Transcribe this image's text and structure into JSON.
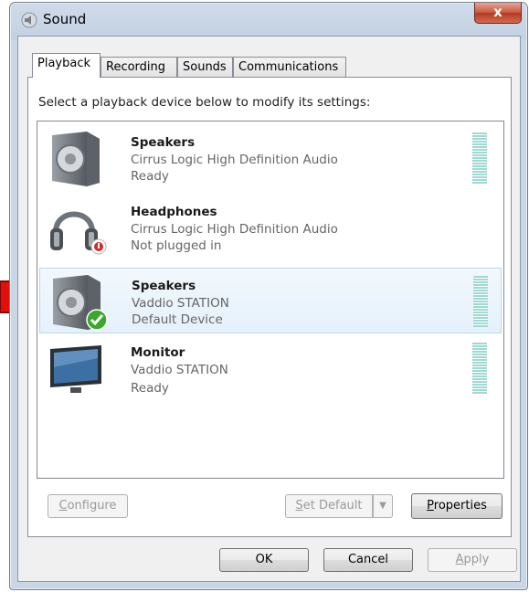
{
  "window": {
    "title": "Sound",
    "close_symbol": "x"
  },
  "tabs": [
    {
      "label": "Playback",
      "active": true
    },
    {
      "label": "Recording",
      "active": false
    },
    {
      "label": "Sounds",
      "active": false
    },
    {
      "label": "Communications",
      "active": false
    }
  ],
  "instruction": "Select a playback device below to modify its settings:",
  "devices": [
    {
      "name": "Speakers",
      "driver": "Cirrus Logic High Definition Audio",
      "status": "Ready",
      "icon": "speaker-icon",
      "selected": false
    },
    {
      "name": "Headphones",
      "driver": "Cirrus Logic High Definition Audio",
      "status": "Not plugged in",
      "icon": "headphones-icon",
      "selected": false
    },
    {
      "name": "Speakers",
      "driver": "Vaddio STATION",
      "status": "Default Device",
      "icon": "speaker-icon",
      "selected": true
    },
    {
      "name": "Monitor",
      "driver": "Vaddio STATION",
      "status": "Ready",
      "icon": "monitor-icon",
      "selected": false
    }
  ],
  "buttons": {
    "configure": {
      "label": "Configure",
      "mnemonic": "C",
      "rest": "onfigure"
    },
    "set_default": {
      "label": "Set Default",
      "mnemonic": "S",
      "rest": "et Default"
    },
    "properties": {
      "label": "Properties",
      "mnemonic": "P",
      "rest": "roperties"
    },
    "ok": {
      "label": "OK"
    },
    "cancel": {
      "label": "Cancel"
    },
    "apply": {
      "label": "Apply",
      "mnemonic": "A",
      "rest": "pply"
    }
  },
  "colors": {
    "pointer_arrow": "#e0100c",
    "default_check": "#3aa82d",
    "unplugged_badge": "#d42a2a"
  }
}
